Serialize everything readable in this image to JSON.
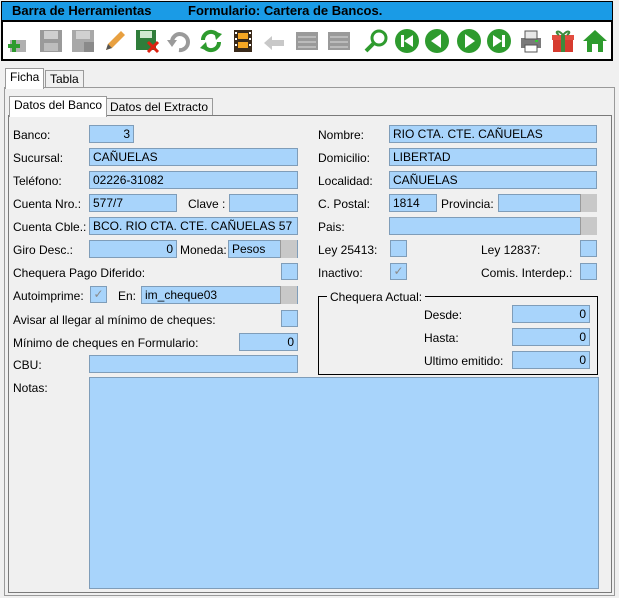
{
  "titlebar": {
    "left": "Barra de Herramientas",
    "right": "Formulario: Cartera de Bancos."
  },
  "toolbar": {
    "buttons": [
      "add-icon",
      "save-icon",
      "save-disabled-icon",
      "edit-icon",
      "save-red-icon",
      "undo-icon",
      "refresh-icon",
      "film-icon",
      "back-arrow-icon",
      "grid-icon",
      "grid-icon",
      "search-icon",
      "first-icon",
      "previous-icon",
      "next-icon",
      "last-icon",
      "printer-icon",
      "gift-icon",
      "home-icon"
    ]
  },
  "tabs": {
    "ficha": "Ficha",
    "tabla": "Tabla"
  },
  "subtabs": {
    "banco": "Datos del Banco",
    "extracto": "Datos del Extracto"
  },
  "form": {
    "banco_label": "Banco:",
    "banco": "3",
    "sucursal_label": "Sucursal:",
    "sucursal": "CAÑUELAS",
    "telefono_label": "Teléfono:",
    "telefono": "02226-31082",
    "cuenta_nro_label": "Cuenta Nro.:",
    "cuenta_nro": "577/7",
    "clave_label": "Clave :",
    "clave": "",
    "cuenta_cble_label": "Cuenta Cble.:",
    "cuenta_cble": "BCO. RIO CTA. CTE. CAÑUELAS 57",
    "giro_label": "Giro Desc.:",
    "giro": "0",
    "moneda_label": "Moneda:",
    "moneda": "Pesos",
    "chequera_pago_label": "Chequera Pago Diferido:",
    "autoimprime_label": "Autoimprime:",
    "en_label": "En:",
    "en": "im_cheque03",
    "avisar_label": "Avisar al llegar al mínimo de cheques:",
    "minimo_label": "Mínimo de cheques en Formulario:",
    "minimo": "0",
    "cbu_label": "CBU:",
    "cbu": "",
    "notas_label": "Notas:",
    "notas": "",
    "nombre_label": "Nombre:",
    "nombre": "RIO CTA. CTE. CAÑUELAS",
    "domicilio_label": "Domicilio:",
    "domicilio": "LIBERTAD",
    "localidad_label": "Localidad:",
    "localidad": "CAÑUELAS",
    "cpostal_label": "C. Postal:",
    "cpostal": "1814",
    "provincia_label": "Provincia:",
    "provincia": "",
    "pais_label": "Pais:",
    "pais": "",
    "ley25413_label": "Ley 25413:",
    "ley12837_label": "Ley 12837:",
    "inactivo_label": "Inactivo:",
    "comis_label": "Comis. Interdep.:",
    "chequera_actual": "Chequera Actual:",
    "desde_label": "Desde:",
    "desde": "0",
    "hasta_label": "Hasta:",
    "hasta": "0",
    "ultimo_label": "Ultimo emitido:",
    "ultimo": "0",
    "check_mark": "✓"
  }
}
